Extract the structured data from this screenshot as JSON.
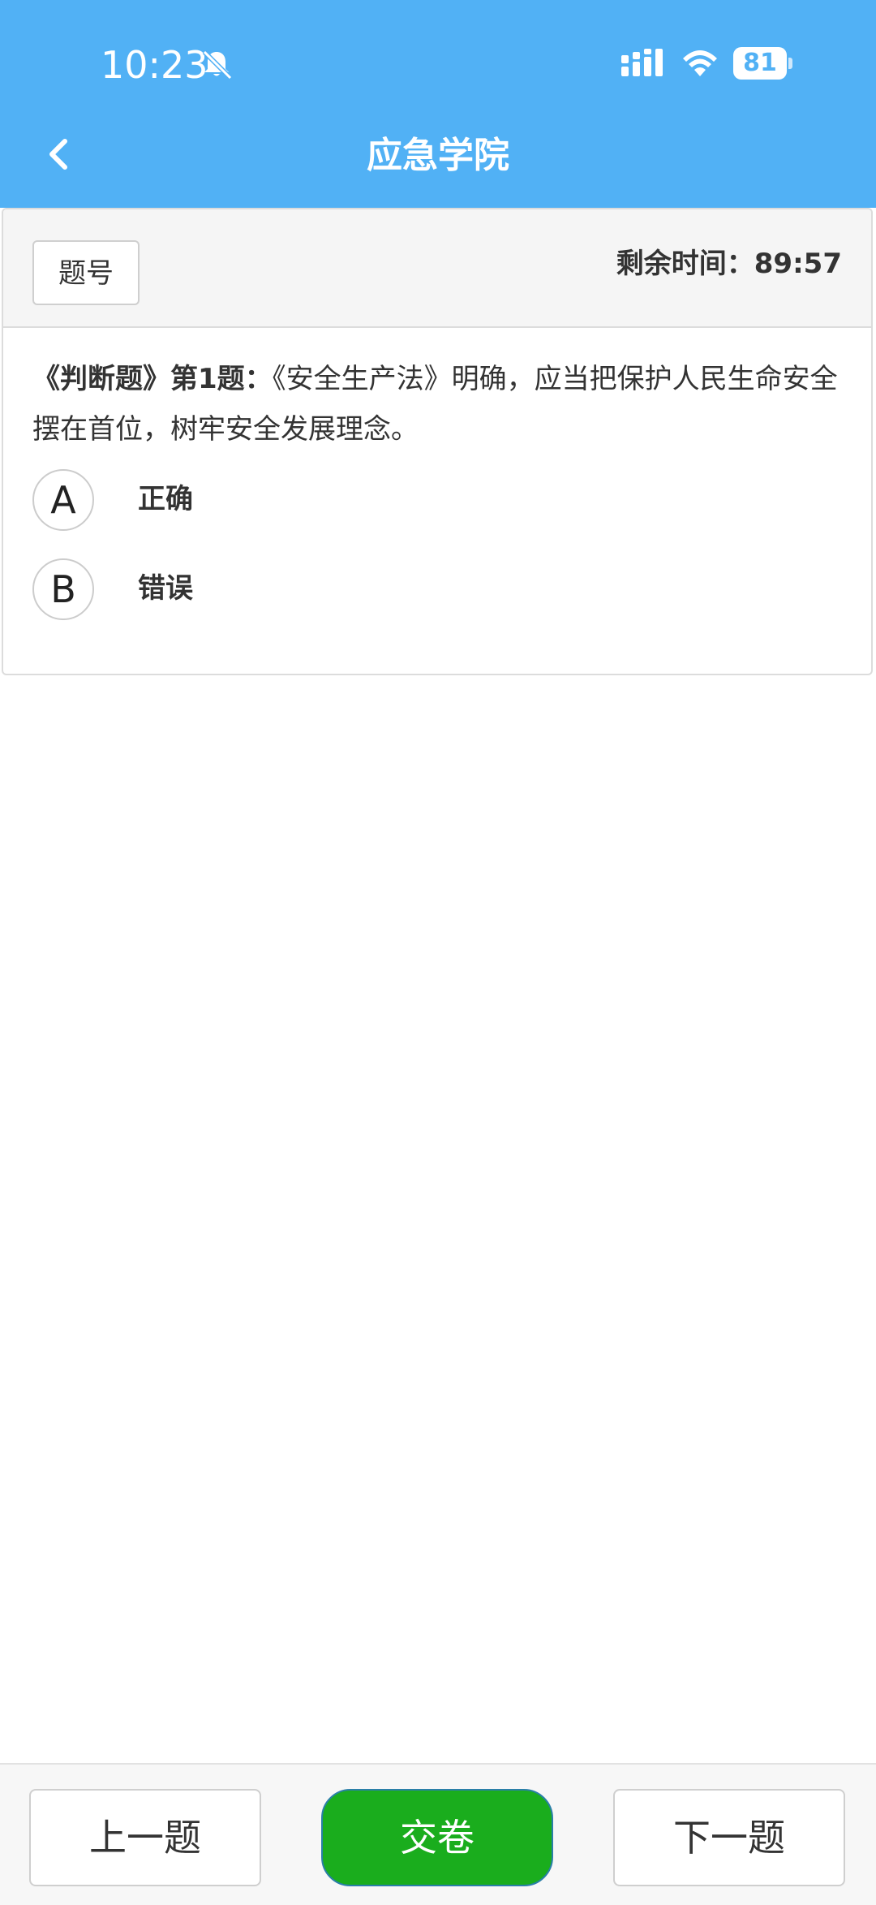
{
  "status_bar": {
    "time": "10:23",
    "battery": "81"
  },
  "header": {
    "title": "应急学院",
    "bg_color": "#51b1f5"
  },
  "card": {
    "question_number_button": "题号",
    "timer": "剩余时间：89:57",
    "question": {
      "type_label": "《判断题》第1题：",
      "text": "《安全生产法》明确，应当把保护人民生命安全摆在首位，树牢安全发展理念。"
    },
    "options": [
      {
        "letter": "A",
        "text": "正确"
      },
      {
        "letter": "B",
        "text": "错误"
      }
    ]
  },
  "footer": {
    "prev_label": "上一题",
    "submit_label": "交卷",
    "next_label": "下一题",
    "submit_color": "#1aad1d"
  },
  "icons": [
    "bell-off-icon",
    "signal-icon",
    "wifi-icon",
    "battery-icon",
    "back-arrow-icon"
  ]
}
